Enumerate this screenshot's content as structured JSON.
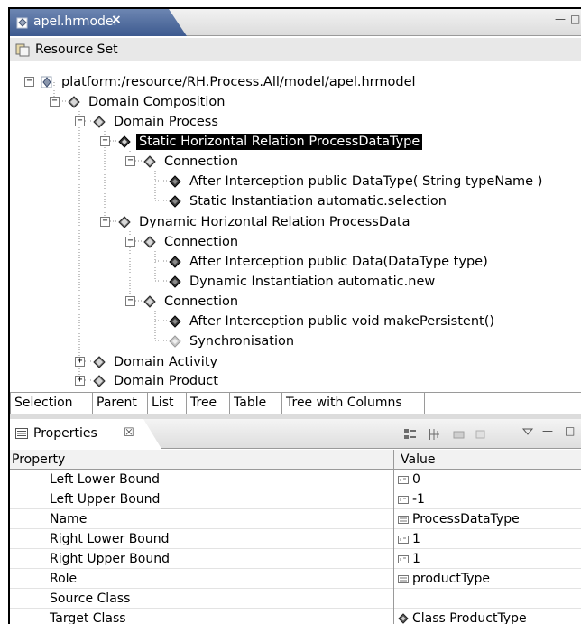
{
  "editor": {
    "tab_title": "apel.hrmodel",
    "close_glyph": "×",
    "minimize_glyph": "—",
    "maximize_glyph": "□"
  },
  "resource_set": {
    "label": "Resource Set"
  },
  "tree": {
    "nodes": [
      {
        "label": "platform:/resource/RH.Process.All/model/apel.hrmodel",
        "expander": "−",
        "icon": "model-file-icon"
      },
      {
        "label": "Domain Composition",
        "expander": "−",
        "icon": "diamond-icon"
      },
      {
        "label": "Domain Process",
        "expander": "−",
        "icon": "diamond-icon"
      },
      {
        "label": "Static Horizontal Relation ProcessDataType",
        "expander": "−",
        "icon": "diamond-icon",
        "selected": true
      },
      {
        "label": "Connection",
        "expander": "−",
        "icon": "diamond-icon"
      },
      {
        "label": "After Interception public DataType( String typeName )",
        "icon": "diamond-icon"
      },
      {
        "label": "Static Instantiation automatic.selection",
        "icon": "diamond-icon"
      },
      {
        "label": "Dynamic Horizontal Relation ProcessData",
        "expander": "−",
        "icon": "diamond-icon"
      },
      {
        "label": "Connection",
        "expander": "−",
        "icon": "diamond-icon"
      },
      {
        "label": "After Interception public Data(DataType type)",
        "icon": "diamond-icon"
      },
      {
        "label": "Dynamic Instantiation automatic.new",
        "icon": "diamond-icon"
      },
      {
        "label": "Connection",
        "expander": "−",
        "icon": "diamond-icon"
      },
      {
        "label": "After Interception public void makePersistent()",
        "icon": "diamond-icon"
      },
      {
        "label": "Synchronisation",
        "icon": "diamond-light-icon"
      },
      {
        "label": "Domain Activity",
        "expander": "+",
        "icon": "diamond-icon"
      },
      {
        "label": "Domain Product",
        "expander": "+",
        "icon": "diamond-icon"
      }
    ]
  },
  "view_tabs": [
    "Selection",
    "Parent",
    "List",
    "Tree",
    "Table",
    "Tree with Columns"
  ],
  "properties": {
    "tab_title": "Properties",
    "close_glyph": "☒",
    "header_property": "Property",
    "header_value": "Value",
    "rows": [
      {
        "name": "Left Lower Bound",
        "value": "0",
        "value_icon": "int-icon"
      },
      {
        "name": "Left Upper Bound",
        "value": "-1",
        "value_icon": "int-icon"
      },
      {
        "name": "Name",
        "value": "ProcessDataType",
        "value_icon": "text-icon"
      },
      {
        "name": "Right Lower Bound",
        "value": "1",
        "value_icon": "int-icon"
      },
      {
        "name": "Right Upper Bound",
        "value": "1",
        "value_icon": "int-icon"
      },
      {
        "name": "Role",
        "value": "productType",
        "value_icon": "text-icon"
      },
      {
        "name": "Source Class",
        "value": "",
        "value_icon": ""
      },
      {
        "name": "Target Class",
        "value": "Class ProductType",
        "value_icon": "diamond-icon"
      }
    ]
  }
}
